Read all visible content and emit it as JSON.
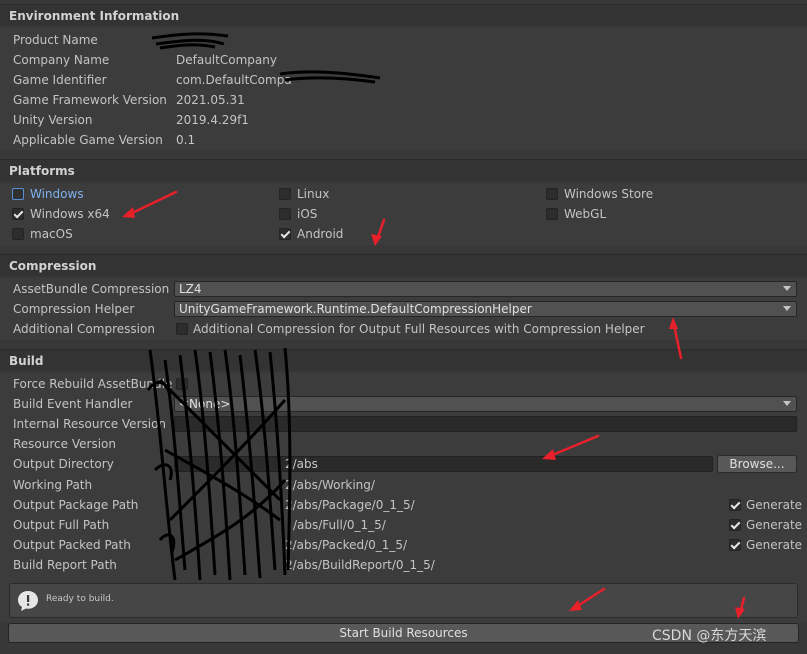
{
  "environment": {
    "header": "Environment Information",
    "rows": [
      {
        "label": "Product Name",
        "value": ""
      },
      {
        "label": "Company Name",
        "value": "DefaultCompany"
      },
      {
        "label": "Game Identifier",
        "value": "com.DefaultCompa"
      },
      {
        "label": "Game Framework Version",
        "value": "2021.05.31"
      },
      {
        "label": "Unity Version",
        "value": "2019.4.29f1"
      },
      {
        "label": "Applicable Game Version",
        "value": "0.1"
      }
    ]
  },
  "platforms": {
    "header": "Platforms",
    "items": [
      {
        "label": "Windows",
        "checked": false
      },
      {
        "label": "Linux",
        "checked": false
      },
      {
        "label": "Windows Store",
        "checked": false
      },
      {
        "label": "Windows x64",
        "checked": true
      },
      {
        "label": "iOS",
        "checked": false
      },
      {
        "label": "WebGL",
        "checked": false
      },
      {
        "label": "macOS",
        "checked": false
      },
      {
        "label": "Android",
        "checked": true
      }
    ]
  },
  "compression": {
    "header": "Compression",
    "assetbundle_label": "AssetBundle Compression",
    "assetbundle_value": "LZ4",
    "helper_label": "Compression Helper",
    "helper_value": "UnityGameFramework.Runtime.DefaultCompressionHelper",
    "additional_label": "Additional Compression",
    "additional_checkbox_label": "Additional Compression for Output Full Resources with Compression Helper"
  },
  "build": {
    "header": "Build",
    "force_rebuild_label": "Force Rebuild AssetBundle",
    "event_handler_label": "Build Event Handler",
    "event_handler_value": "<None>",
    "internal_version_label": "Internal Resource Version",
    "resource_version_label": "Resource Version",
    "output_dir_label": "Output Directory",
    "output_dir_value": "2/abs",
    "browse_label": "Browse...",
    "working_label": "Working Path",
    "working_value": "2/abs/Working/",
    "package_label": "Output Package Path",
    "package_value": "2/abs/Package/0_1_5/",
    "full_label": "Output Full Path",
    "full_value": "/abs/Full/0_1_5/",
    "packed_label": "Output Packed Path",
    "packed_value": "2/abs/Packed/0_1_5/",
    "report_label": "Build Report Path",
    "report_value": "2/abs/BuildReport/0_1_5/",
    "generate_label": "Generate"
  },
  "status": {
    "message": "Ready to build."
  },
  "actions": {
    "start_label": "Start Build Resources"
  },
  "watermark": "CSDN @东方天滨",
  "colors": {
    "panel_bg": "#3c3c3c",
    "header_bg": "#333333",
    "annotation_red": "#e8202a",
    "scribble": "#000000"
  }
}
